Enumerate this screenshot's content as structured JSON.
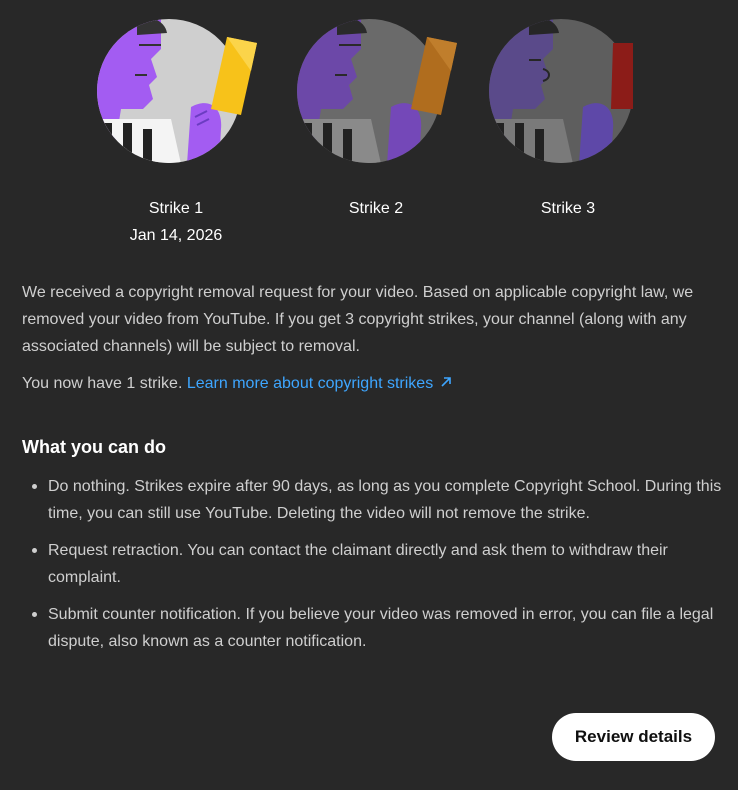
{
  "strikes": [
    {
      "label": "Strike 1",
      "date": "Jan 14, 2026",
      "card_color": "#f7c21a",
      "skin_color": "#a060f0",
      "active": true
    },
    {
      "label": "Strike 2",
      "date": "",
      "card_color": "#b06d1e",
      "skin_color": "#6c48a8",
      "active": false
    },
    {
      "label": "Strike 3",
      "date": "",
      "card_color": "#8c1c18",
      "skin_color": "#5a4a8a",
      "active": false
    }
  ],
  "notice": {
    "paragraph": "We received a copyright removal request for your video. Based on applicable copyright law, we removed your video from YouTube. If you get 3 copyright strikes, your channel (along with any associated channels) will be subject to removal.",
    "count_text": "You now have 1 strike.",
    "learn_more_link": "Learn more about copyright strikes"
  },
  "what_you_can_do": {
    "title": "What you can do",
    "items": [
      "Do nothing. Strikes expire after 90 days, as long as you complete Copyright School. During this time, you can still use YouTube. Deleting the video will not remove the strike.",
      "Request retraction. You can contact the claimant directly and ask them to withdraw their complaint.",
      "Submit counter notification. If you believe your video was removed in error, you can file a legal dispute, also known as a counter notification."
    ]
  },
  "review_button": {
    "label": "Review details"
  },
  "colors": {
    "background": "#282828",
    "link": "#3ea6ff",
    "button_bg": "#ffffff"
  },
  "icons": {
    "external_link": "arrow-up-right-icon"
  }
}
